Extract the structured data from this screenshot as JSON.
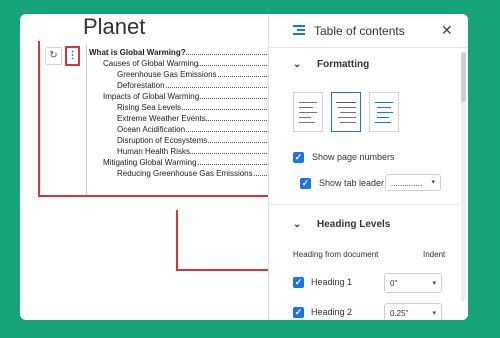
{
  "document": {
    "title": "Planet",
    "refresh_icon": "↻",
    "more_icon": "⋮",
    "toc_entries": [
      {
        "text": "What is Global Warming?",
        "level": 0,
        "bold": true
      },
      {
        "text": "Causes of Global Warming",
        "level": 1,
        "bold": false
      },
      {
        "text": "Greenhouse Gas Emissions",
        "level": 2,
        "bold": false
      },
      {
        "text": "Deforestation",
        "level": 2,
        "bold": false
      },
      {
        "text": "Impacts of Global Warming",
        "level": 1,
        "bold": false
      },
      {
        "text": "Rising Sea Levels",
        "level": 2,
        "bold": false
      },
      {
        "text": "Extreme Weather Events",
        "level": 2,
        "bold": false
      },
      {
        "text": "Ocean Acidification",
        "level": 2,
        "bold": false
      },
      {
        "text": "Disruption of Ecosystems",
        "level": 2,
        "bold": false
      },
      {
        "text": "Human Health Risks",
        "level": 2,
        "bold": false
      },
      {
        "text": "Mitigating Global Warming",
        "level": 1,
        "bold": false
      },
      {
        "text": "Reducing Greenhouse Gas Emissions",
        "level": 2,
        "bold": false
      }
    ]
  },
  "panel": {
    "title": "Table of contents",
    "close_icon": "✕",
    "formatting": {
      "label": "Formatting",
      "chevron": "⌄",
      "styles": [
        "plain-text",
        "dotted",
        "links"
      ],
      "selected_style": "dotted",
      "show_page_numbers": {
        "label": "Show page numbers",
        "checked": true
      },
      "show_tab_leader": {
        "label": "Show tab leader",
        "checked": true,
        "value": "..............",
        "caret": "▾"
      }
    },
    "heading_levels": {
      "label": "Heading Levels",
      "chevron": "⌄",
      "heading_from_document": "Heading from document",
      "indent_label": "Indent",
      "rows": [
        {
          "label": "Heading 1",
          "checked": true,
          "indent": "0\"",
          "caret": "▾"
        },
        {
          "label": "Heading 2",
          "checked": true,
          "indent": "0.25\"",
          "caret": "▾"
        }
      ]
    },
    "check_mark": "✓"
  },
  "colors": {
    "background": "#17a37a",
    "highlight": "#d8343d",
    "accent": "#1a73e8"
  }
}
